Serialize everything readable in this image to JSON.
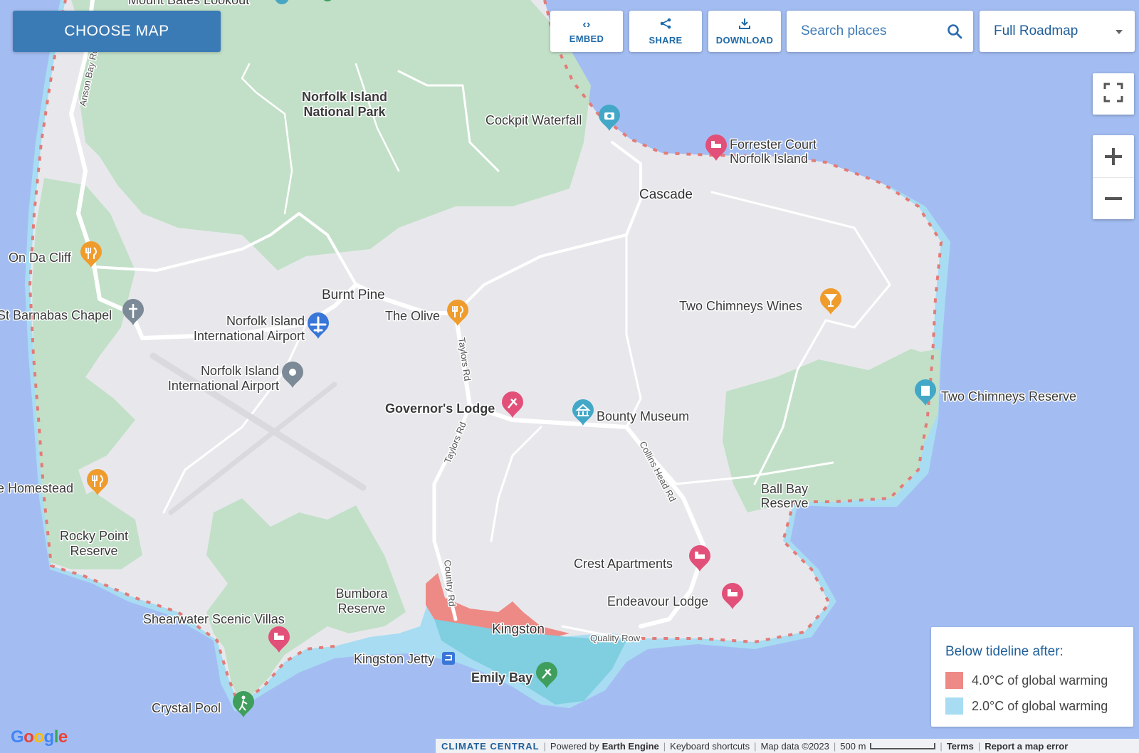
{
  "toolbar": {
    "choose_map": "CHOOSE MAP",
    "embed": "EMBED",
    "share": "SHARE",
    "download": "DOWNLOAD",
    "search_placeholder": "Search places",
    "map_type": "Full Roadmap"
  },
  "icons": {
    "embed": "code-icon",
    "share": "share-icon",
    "download": "download-icon",
    "search": "search-icon",
    "dropdown": "caret-down-icon",
    "fullscreen": "fullscreen-icon",
    "zoom_in": "zoom-in-icon",
    "zoom_out": "zoom-out-icon"
  },
  "legend": {
    "title": "Below tideline after:",
    "items": [
      {
        "label": "4.0°C of global warming",
        "color": "#ee8a85"
      },
      {
        "label": "2.0°C of global warming",
        "color": "#a7dcf2"
      }
    ]
  },
  "map_labels": {
    "mount_bates": "Mount Bates Lookout",
    "anson_bay_rd": "Anson Bay Rd",
    "national_park_1": "Norfolk Island",
    "national_park_2": "National Park",
    "cockpit_waterfall": "Cockpit Waterfall",
    "forrester_1": "Forrester Court",
    "forrester_2": "Norfolk Island",
    "cascade": "Cascade",
    "on_da_cliff": "On Da Cliff",
    "burnt_pine": "Burnt Pine",
    "barnabas": "St Barnabas Chapel",
    "airport_a1": "Norfolk Island",
    "airport_a2": "International Airport",
    "the_olive": "The Olive",
    "two_chimneys_wines": "Two Chimneys Wines",
    "airport_b1": "Norfolk Island",
    "airport_b2": "International Airport",
    "taylors_rd_1": "Taylors Rd",
    "two_chimneys_reserve": "Two Chimneys Reserve",
    "governors_lodge": "Governor's Lodge",
    "bounty_museum": "Bounty Museum",
    "taylors_rd_2": "Taylors Rd",
    "collins_head_rd": "Collins Head Rd",
    "homestead": "e Homestead",
    "ball_bay_1": "Ball Bay",
    "ball_bay_2": "Reserve",
    "rocky_point_1": "Rocky Point",
    "rocky_point_2": "Reserve",
    "crest_apartments": "Crest Apartments",
    "country_rd": "Country Rd",
    "endeavour_lodge": "Endeavour Lodge",
    "bumbora_1": "Bumbora",
    "bumbora_2": "Reserve",
    "shearwater": "Shearwater Scenic Villas",
    "kingston": "Kingston",
    "quality_row": "Quality Row",
    "kingston_jetty": "Kingston Jetty",
    "emily_bay": "Emily Bay",
    "crystal_pool": "Crystal Pool"
  },
  "footer": {
    "google": "Google",
    "climate_central": "CLIMATE CENTRAL",
    "powered_by": "Powered by",
    "earth_engine": "Earth Engine",
    "keyboard_shortcuts": "Keyboard shortcuts",
    "map_data": "Map data ©2023",
    "scale": "500 m",
    "terms": "Terms",
    "report": "Report a map error"
  }
}
